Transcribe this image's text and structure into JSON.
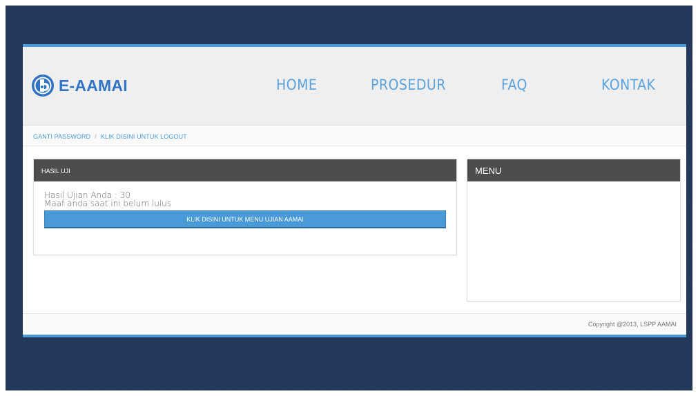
{
  "brand": {
    "name": "E-AAMAI",
    "accent_color": "#4a9ad8",
    "background_color": "#213659"
  },
  "nav": {
    "items": [
      {
        "label": "HOME"
      },
      {
        "label": "PROSEDUR"
      },
      {
        "label": "FAQ"
      },
      {
        "label": "KONTAK"
      }
    ]
  },
  "breadcrumb": {
    "change_password": "GANTI PASSWORD",
    "separator": "/",
    "logout": "KLIK DISINI UNTUK LOGOUT"
  },
  "result_panel": {
    "title": "HASIL UJI",
    "score_line": "Hasil Ujian Anda : 30",
    "status_line": "Maaf anda saat ini belum lulus",
    "button_label": "KLIK DISINI UNTUK MENU UJIAN AAMAI"
  },
  "menu_panel": {
    "title": "MENU"
  },
  "footer": {
    "copyright": "Copyright @2013, LSPP AAMAI"
  }
}
